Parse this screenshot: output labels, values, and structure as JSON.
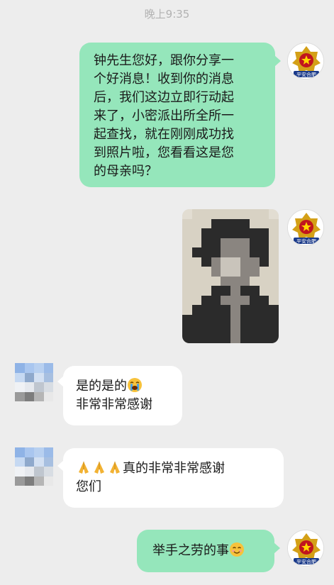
{
  "status": {
    "time": "晚上9:35"
  },
  "messages": [
    {
      "side": "out",
      "sender_avatar_text": "平安合肥",
      "lines": [
        "钟先生您好，跟你分享一",
        "个好消息！收到你的消息",
        "后，我们这边立即行动起",
        "来了，小密派出所全所一",
        "起查找，就在刚刚成功找",
        "到照片啦，您看看这是您",
        "的母亲吗？"
      ]
    },
    {
      "side": "out",
      "type": "image",
      "sender_avatar_text": "平安合肥"
    },
    {
      "side": "in",
      "lines": [
        "是的是的",
        "非常非常感谢"
      ],
      "emoji": "loudly-crying-face-icon"
    },
    {
      "side": "in",
      "lines": [
        "真的非常非常感谢",
        "您们"
      ],
      "emoji": "folded-hands-icon"
    },
    {
      "side": "out",
      "lines": [
        "举手之劳的事"
      ],
      "emoji": "smiling-face-icon",
      "sender_avatar_text": "平安合肥"
    }
  ],
  "colors": {
    "outgoing_bubble": "#95e6bb",
    "incoming_bubble": "#ffffff",
    "background": "#ededed"
  }
}
